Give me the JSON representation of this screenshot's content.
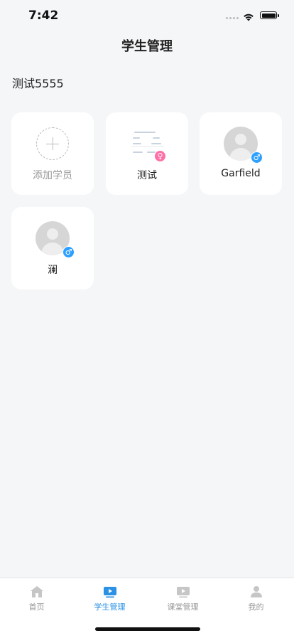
{
  "status_bar": {
    "time": "7:42"
  },
  "header": {
    "title": "学生管理"
  },
  "class": {
    "name": "测试5555"
  },
  "add_card": {
    "label": "添加学员"
  },
  "students": [
    {
      "name": "测试",
      "gender": "female",
      "gender_symbol": "♀"
    },
    {
      "name": "Garfield",
      "gender": "male",
      "gender_symbol": "♂"
    },
    {
      "name": "澜",
      "gender": "male",
      "gender_symbol": "♂"
    }
  ],
  "tabs": [
    {
      "label": "首页",
      "icon": "home-icon",
      "active": false
    },
    {
      "label": "学生管理",
      "icon": "student-play-icon",
      "active": true
    },
    {
      "label": "课堂管理",
      "icon": "classroom-play-icon",
      "active": false
    },
    {
      "label": "我的",
      "icon": "profile-icon",
      "active": false
    }
  ],
  "colors": {
    "accent": "#2a91e5",
    "male": "#2ea0ff",
    "female": "#ff6fa7",
    "background": "#f5f6f8"
  }
}
